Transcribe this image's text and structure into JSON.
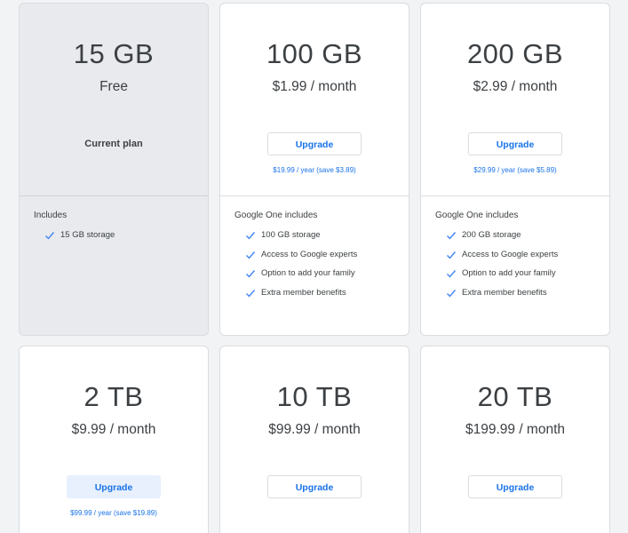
{
  "plans": [
    {
      "storage": "15 GB",
      "price": "Free",
      "current_label": "Current plan",
      "includes_title": "Includes",
      "features": [
        "15 GB storage"
      ]
    },
    {
      "storage": "100 GB",
      "price": "$1.99 / month",
      "button": "Upgrade",
      "yearly": "$19.99 / year (save $3.89)",
      "includes_title": "Google One includes",
      "features": [
        "100 GB storage",
        "Access to Google experts",
        "Option to add your family",
        "Extra member benefits"
      ]
    },
    {
      "storage": "200 GB",
      "price": "$2.99 / month",
      "button": "Upgrade",
      "yearly": "$29.99 / year (save $5.89)",
      "includes_title": "Google One includes",
      "features": [
        "200 GB storage",
        "Access to Google experts",
        "Option to add your family",
        "Extra member benefits"
      ]
    },
    {
      "storage": "2 TB",
      "price": "$9.99 / month",
      "button": "Upgrade",
      "yearly": "$99.99 / year (save $19.89)"
    },
    {
      "storage": "10 TB",
      "price": "$99.99 / month",
      "button": "Upgrade"
    },
    {
      "storage": "20 TB",
      "price": "$199.99 / month",
      "button": "Upgrade"
    }
  ],
  "colors": {
    "accent": "#1a73e8",
    "check": "#4285f4",
    "current_bg": "#e8eaed",
    "highlight_btn_bg": "#e8f0fe"
  },
  "icons": {
    "check": "check-icon"
  }
}
